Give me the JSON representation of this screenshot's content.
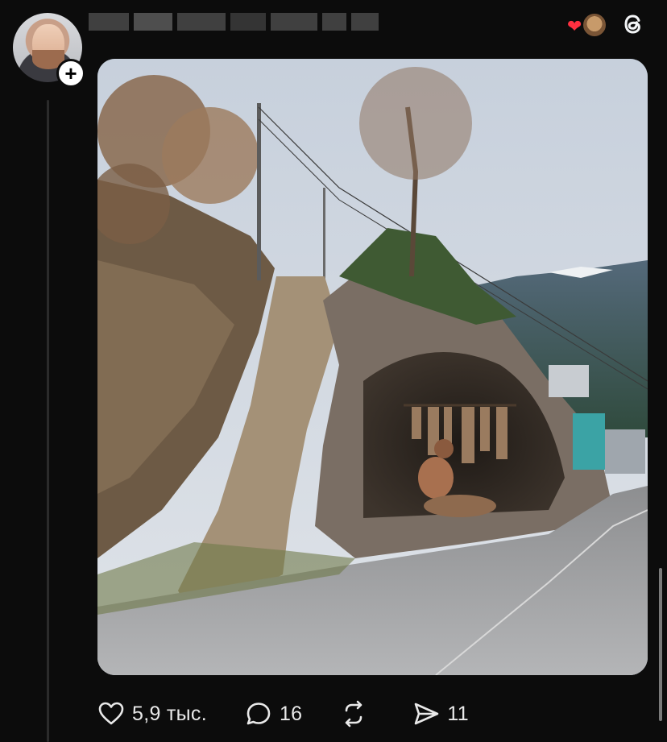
{
  "post": {
    "author": {
      "avatar_icon": "profile-photo",
      "follow_icon": "plus-icon",
      "follow_label": "+"
    },
    "header": {
      "activity_icon": "heart-icon",
      "activity_color": "#ff3040",
      "app_logo": "threads-logo-icon"
    },
    "image": {
      "alt": ""
    },
    "actions": {
      "like_count": "5,9 тыс.",
      "comment_count": "16",
      "repost_count": "",
      "share_count": "11"
    }
  },
  "colors": {
    "background": "#0c0c0c",
    "text": "#f3f5f7",
    "heart": "#ff3040"
  }
}
